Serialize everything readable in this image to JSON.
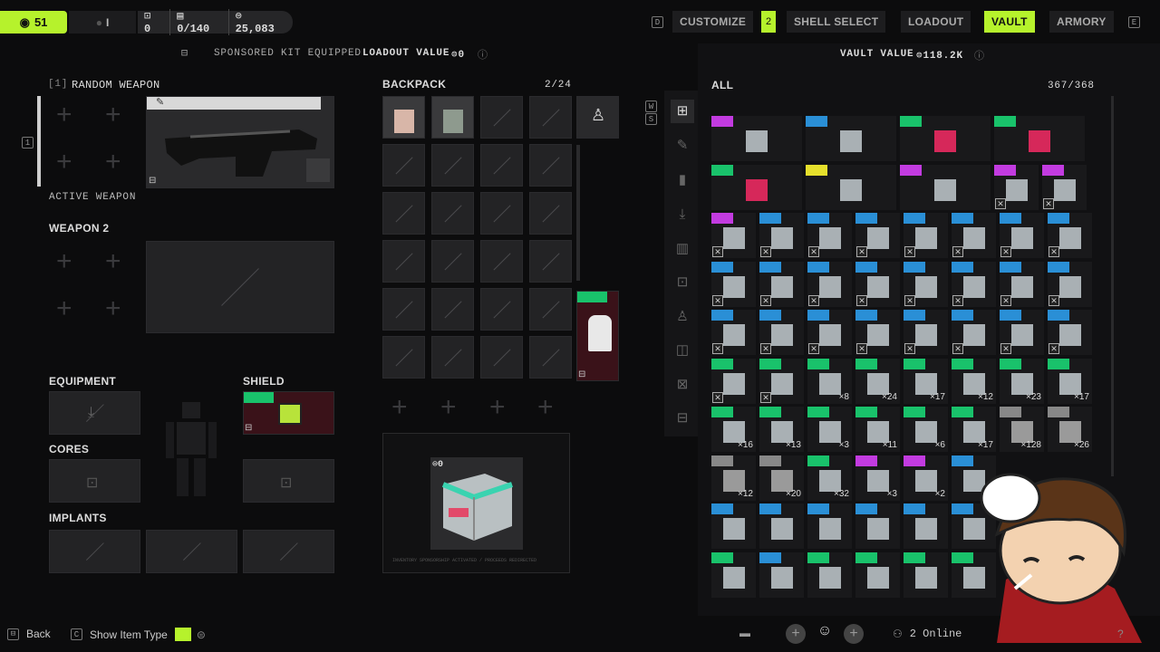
{
  "topbar": {
    "level": "51",
    "rank": "I",
    "stats": [
      {
        "icon": "inventory-icon",
        "value": "0"
      },
      {
        "icon": "stash-icon",
        "value": "0/140"
      },
      {
        "icon": "credits-icon",
        "value": "25,083"
      }
    ],
    "nav": [
      {
        "label": "CUSTOMIZE",
        "badge": "2",
        "key": "D"
      },
      {
        "label": "SHELL SELECT"
      },
      {
        "label": "LOADOUT"
      },
      {
        "label": "VAULT",
        "active": true
      },
      {
        "label": "ARMORY",
        "key": "E"
      }
    ]
  },
  "loadout": {
    "sponsored_text": "SPONSORED KIT EQUIPPED",
    "loadout_value_label": "LOADOUT VALUE",
    "loadout_value": "0",
    "weapon1_prefix": "[1]",
    "weapon1_name": "RANDOM WEAPON",
    "active_weapon_label": "ACTIVE WEAPON",
    "weapon2_label": "WEAPON 2",
    "equipment_label": "EQUIPMENT",
    "shield_label": "SHIELD",
    "cores_label": "CORES",
    "implants_label": "IMPLANTS"
  },
  "backpack": {
    "label": "BACKPACK",
    "count": "2/24",
    "crate_value": "0",
    "crate_caption": "INVENTORY SPONSORSHIP ACTIVATED / PROCEEDS REDIRECTED"
  },
  "vault": {
    "value_label": "VAULT VALUE",
    "value": "118.2K",
    "filter": "ALL",
    "count": "367/368"
  },
  "vault_rows": [
    [
      {
        "c": "#c23be0"
      },
      {
        "c": "#2a8fd6"
      },
      {
        "c": "#19c26b"
      },
      {
        "c": "#19c26b"
      }
    ],
    [
      {
        "c": "#19c26b"
      },
      {
        "c": "#e6e02c"
      },
      {
        "c": "#c23be0"
      },
      {
        "c": "#c23be0",
        "x": true
      },
      {
        "c": "#c23be0",
        "x": true
      }
    ],
    [
      {
        "c": "#c23be0",
        "x": true
      },
      {
        "c": "#2a8fd6",
        "x": true
      },
      {
        "c": "#2a8fd6",
        "x": true
      },
      {
        "c": "#2a8fd6",
        "x": true
      },
      {
        "c": "#2a8fd6",
        "x": true
      },
      {
        "c": "#2a8fd6",
        "x": true
      },
      {
        "c": "#2a8fd6",
        "x": true
      },
      {
        "c": "#2a8fd6",
        "x": true
      }
    ],
    [
      {
        "c": "#2a8fd6",
        "x": true
      },
      {
        "c": "#2a8fd6",
        "x": true
      },
      {
        "c": "#2a8fd6",
        "x": true
      },
      {
        "c": "#2a8fd6",
        "x": true
      },
      {
        "c": "#2a8fd6",
        "x": true
      },
      {
        "c": "#2a8fd6",
        "x": true
      },
      {
        "c": "#2a8fd6",
        "x": true
      },
      {
        "c": "#2a8fd6",
        "x": true
      }
    ],
    [
      {
        "c": "#2a8fd6",
        "x": true
      },
      {
        "c": "#2a8fd6",
        "x": true
      },
      {
        "c": "#2a8fd6",
        "x": true
      },
      {
        "c": "#2a8fd6",
        "x": true
      },
      {
        "c": "#2a8fd6",
        "x": true
      },
      {
        "c": "#2a8fd6",
        "x": true
      },
      {
        "c": "#2a8fd6",
        "x": true
      },
      {
        "c": "#2a8fd6",
        "x": true
      }
    ],
    [
      {
        "c": "#19c26b",
        "x": true
      },
      {
        "c": "#19c26b",
        "x": true
      },
      {
        "c": "#19c26b",
        "q": "×8"
      },
      {
        "c": "#19c26b",
        "q": "×24"
      },
      {
        "c": "#19c26b",
        "q": "×17"
      },
      {
        "c": "#19c26b",
        "q": "×12"
      },
      {
        "c": "#19c26b",
        "q": "×23"
      },
      {
        "c": "#19c26b",
        "q": "×17"
      }
    ],
    [
      {
        "c": "#19c26b",
        "q": "×16"
      },
      {
        "c": "#19c26b",
        "q": "×13"
      },
      {
        "c": "#19c26b",
        "q": "×3"
      },
      {
        "c": "#19c26b",
        "q": "×11"
      },
      {
        "c": "#19c26b",
        "q": "×6"
      },
      {
        "c": "#19c26b",
        "q": "×17"
      },
      {
        "c": "#888",
        "q": "×128"
      },
      {
        "c": "#888",
        "q": "×26"
      }
    ],
    [
      {
        "c": "#888",
        "q": "×12"
      },
      {
        "c": "#888",
        "q": "×20"
      },
      {
        "c": "#19c26b",
        "q": "×32"
      },
      {
        "c": "#c23be0",
        "q": "×3"
      },
      {
        "c": "#c23be0",
        "q": "×2"
      },
      {
        "c": "#2a8fd6"
      }
    ],
    [
      {
        "c": "#2a8fd6"
      },
      {
        "c": "#2a8fd6"
      },
      {
        "c": "#2a8fd6"
      },
      {
        "c": "#2a8fd6"
      },
      {
        "c": "#2a8fd6"
      },
      {
        "c": "#2a8fd6"
      }
    ],
    [
      {
        "c": "#19c26b"
      },
      {
        "c": "#2a8fd6"
      },
      {
        "c": "#19c26b"
      },
      {
        "c": "#19c26b"
      },
      {
        "c": "#19c26b"
      },
      {
        "c": "#19c26b"
      }
    ]
  ],
  "footer": {
    "back": "Back",
    "show_item_type": "Show Item Type",
    "online": "2 Online"
  }
}
